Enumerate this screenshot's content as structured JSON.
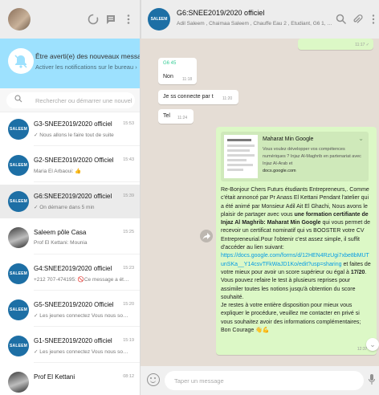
{
  "sidebar": {
    "notification": {
      "title": "Être averti(e) des nouveaux messages",
      "subtitle": "Activer les notifications sur le bureau ›"
    },
    "search": {
      "placeholder": "Rechercher ou démarrer une nouvelle di..."
    },
    "chats": [
      {
        "name": "G3-SNEE2019/2020 officiel",
        "time": "15:53",
        "preview": "✓ Nous allons le faire tout de suite",
        "avatar": "SALEEM"
      },
      {
        "name": "G2-SNEE2019/2020 Officiel",
        "time": "15:43",
        "preview": "Maria El Arbaoui: 👍",
        "avatar": "SALEEM"
      },
      {
        "name": "G6:SNEE2019/2020 officiel",
        "time": "15:39",
        "preview": "✓ On démarre dans 5 min",
        "avatar": "SALEEM"
      },
      {
        "name": "Saleem pôle Casa",
        "time": "15:25",
        "preview": "Prof El Kettani: Mounia",
        "avatar": ""
      },
      {
        "name": "G4:SNEE2019/2020 officiel",
        "time": "15:23",
        "preview": "+212 707-474195: 🚫Ce message a été ...",
        "avatar": "SALEEM"
      },
      {
        "name": "G5-SNEE2019/2020 Officiel",
        "time": "15:20",
        "preview": "✓ Les jeunes connectez Vous nous som...",
        "avatar": "SALEEM"
      },
      {
        "name": "G1-SNEE2019/2020 officiel",
        "time": "15:19",
        "preview": "✓ Les jeunes connectez Vous nous som...",
        "avatar": "SALEEM"
      },
      {
        "name": "Prof El Kettani",
        "time": "08:12",
        "preview": "",
        "avatar": ""
      }
    ]
  },
  "header": {
    "avatar": "SALEEM",
    "title": "G6:SNEE2019/2020 officiel",
    "subtitle": "Adil Saleem , Chaimaa Saleem , Chauffe Eau 2 , Etudiant, G6 1, G6 10, G..."
  },
  "messages": [
    {
      "text": "",
      "time": "11:17 ✓",
      "dir": "out"
    },
    {
      "sender": "G6 45",
      "text": "Non",
      "time": "11:18",
      "dir": "in"
    },
    {
      "text": "Je ss connecte par t",
      "time": "11:20",
      "dir": "in"
    },
    {
      "text": "Tel",
      "time": "11:24",
      "dir": "in"
    }
  ],
  "link_preview": {
    "title": "Maharat Min Google",
    "description": "Vous voulez développer vos compétences numériques ? Injaz Al-Maghrib en partenariat avec Injaz Al-Arab et",
    "domain": "docs.google.com"
  },
  "long_message": {
    "p1": "Re-Bonjour Chers Futurs étudiants Entrepreneurs,. Comme c'était annoncé par Pr Anass El Kettani Pendant l'atelier qui a été animé par Monsieur Adil Ait El Ghachi, Nous avons le plaisir de partager avec vous ",
    "p1_bold": "une formation certifiante de Injaz Al Maghrib: Maharat Min Google",
    "p1_end": " qui vous permet de recevoir un certificat nominatif qui vs BOOSTER votre CV Entrepreneurial.Pour l'obtenir c'est assez simple, il suffit d'accéder au lien suivant:",
    "link": "https://docs.google.com/forms/d/12HEN4RzUgi7xbe8bMUTunSKa__Y14csvTFkWaJD1Ko/edit?usp=sharing",
    "p2": " et faites de votre mieux pour avoir un score supérieur ou égal à ",
    "p2_bold": "17/20",
    "p2_end": ". Vous pouvez refaire le test à plusieurs reprises pour assimiler toutes les notions jusqu'à obtention du score souhaité.",
    "p3": "Je restes à votre entière disposition pour mieux vous expliquer le procédure, veuillez me contacter en privé si vous souhaitez avoir des informations complémentaires; Bon Courage 👋💪",
    "time": "12:37 ✓"
  },
  "composer": {
    "placeholder": "Taper un message"
  },
  "colors": {
    "notification": "#9de1fe",
    "outgoing": "#dcf8c6",
    "link": "#039be5",
    "background": "#e5ddd5"
  }
}
